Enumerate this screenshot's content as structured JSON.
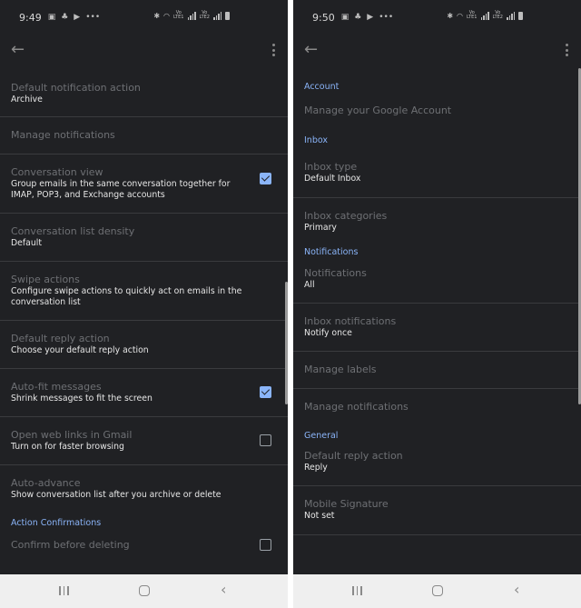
{
  "left_screen": {
    "status_bar": {
      "time": "9:49"
    },
    "items": [
      {
        "title": "Default notification action",
        "subtitle": "Archive"
      },
      {
        "title": "Manage notifications"
      },
      {
        "title": "Conversation view",
        "subtitle": "Group emails in the same conversation together for IMAP, POP3, and Exchange accounts",
        "checked": true
      },
      {
        "title": "Conversation list density",
        "subtitle": "Default"
      },
      {
        "title": "Swipe actions",
        "subtitle": "Configure swipe actions to quickly act on emails in the conversation list"
      },
      {
        "title": "Default reply action",
        "subtitle": "Choose your default reply action"
      },
      {
        "title": "Auto-fit messages",
        "subtitle": "Shrink messages to fit the screen",
        "checked": true
      },
      {
        "title": "Open web links in Gmail",
        "subtitle": "Turn on for faster browsing",
        "checked": false
      },
      {
        "title": "Auto-advance",
        "subtitle": "Show conversation list after you archive or delete"
      }
    ],
    "section_action_confirmations": "Action Confirmations",
    "confirm_item": {
      "title": "Confirm before deleting",
      "checked": false
    }
  },
  "right_screen": {
    "status_bar": {
      "time": "9:50"
    },
    "sections": {
      "account": "Account",
      "inbox": "Inbox",
      "notifications": "Notifications",
      "general": "General"
    },
    "items": {
      "manage_account": {
        "title": "Manage your Google Account"
      },
      "inbox_type": {
        "title": "Inbox type",
        "subtitle": "Default Inbox"
      },
      "inbox_categories": {
        "title": "Inbox categories",
        "subtitle": "Primary"
      },
      "notifications": {
        "title": "Notifications",
        "subtitle": "All"
      },
      "inbox_notifications": {
        "title": "Inbox notifications",
        "subtitle": "Notify once"
      },
      "manage_labels": {
        "title": "Manage labels"
      },
      "manage_notifications": {
        "title": "Manage notifications"
      },
      "default_reply": {
        "title": "Default reply action",
        "subtitle": "Reply"
      },
      "mobile_signature": {
        "title": "Mobile Signature",
        "subtitle": "Not set"
      }
    }
  },
  "colors": {
    "background": "#202124",
    "accent": "#8ab4f8",
    "divider": "#3a3b3e",
    "nav_bar": "#efefef"
  }
}
